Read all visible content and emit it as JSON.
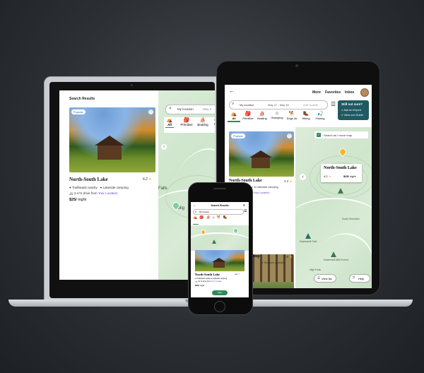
{
  "laptop": {
    "header": "Search Results",
    "search_value": "My location",
    "search_date": "May 2",
    "tabs": [
      {
        "label": "All"
      },
      {
        "label": "Primitive"
      },
      {
        "label": "Boating"
      },
      {
        "label": "Gl"
      }
    ],
    "card": {
      "badge": "Popular",
      "title": "North-South Lake",
      "rating": "4.2",
      "feature1": "Trailheads nearby",
      "feature2": "Lakeside camping",
      "drive_prefix": "3.4 hr drive from",
      "drive_link": "Your Location",
      "price": "$25/",
      "price_unit": "night"
    },
    "map_labels": [
      "Falls",
      "Twilig"
    ]
  },
  "tablet": {
    "nav": [
      "More",
      "Favorites",
      "Inbox"
    ],
    "search_value": "My location",
    "search_dates": "May 27 - May 30",
    "search_guests": "Add Guests",
    "help_box": {
      "title": "Still not sure?",
      "item1": "Ask an Expert",
      "item2": "View our Guide"
    },
    "categories": [
      {
        "label": "All"
      },
      {
        "label": "Primitive"
      },
      {
        "label": "Boating"
      },
      {
        "label": "Glamping"
      },
      {
        "label": "Dogs ok"
      },
      {
        "label": "Hiking"
      },
      {
        "label": "Fishing"
      }
    ],
    "search_as_move": "Search as I move map",
    "card1": {
      "badge": "Popular",
      "title": "North-South Lake",
      "rating": "4.2",
      "feature1": "Trailheads nearby",
      "feature2": "Lakeside camping",
      "drive_prefix": "3.4 hr drive from",
      "drive_link": "Your Location",
      "price": "$25/",
      "price_unit": "night"
    },
    "card2": {
      "title": "e Camp",
      "rating": "3.9",
      "feature": "Showers available"
    },
    "map_popup": {
      "title": "North-South Lake",
      "rating": "4.2",
      "price": "$25/",
      "price_unit": "night"
    },
    "map_labels": [
      "South Mountain",
      "Kaaterskill Falls",
      "Kaaterskill Wild Forest",
      "High Peak"
    ],
    "view_list": "View list",
    "help": "Help"
  },
  "phone": {
    "header": "Search Results",
    "search_value": "My location",
    "card": {
      "title": "North-South Lake",
      "rating": "4.2",
      "feature1": "Trailheads nearby",
      "feature2": "Lakeside camping",
      "drive_prefix": "3.4 hr drive from",
      "drive_link": "Your Location",
      "price": "$25/",
      "price_unit": "night"
    },
    "map_button": "Map"
  },
  "colors": {
    "brand_green": "#2e8b57",
    "link_purple": "#6b3fd1",
    "star": "#f2b632",
    "help_box_bg": "#1f5a63"
  }
}
